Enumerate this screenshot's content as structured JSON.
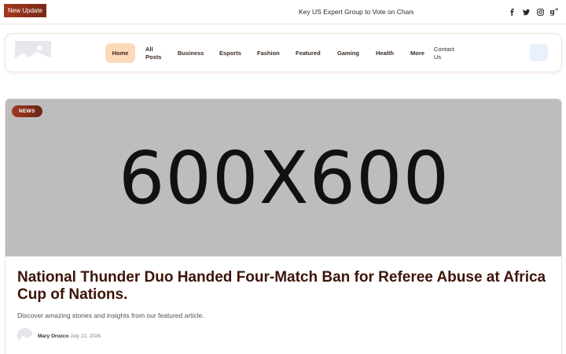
{
  "topbar": {
    "badge_label": "New Update",
    "ticker_text": "Key US Expert Group to Vote on Changing",
    "socials": [
      "facebook-icon",
      "twitter-icon",
      "instagram-icon",
      "google-plus-icon"
    ]
  },
  "header": {
    "nav": [
      {
        "label": "Home",
        "active": true
      },
      {
        "label": "All\nPosts"
      },
      {
        "label": "Business"
      },
      {
        "label": "Esports"
      },
      {
        "label": "Fashion"
      },
      {
        "label": "Featured"
      },
      {
        "label": "Gaming"
      },
      {
        "label": "Health"
      },
      {
        "label": "More"
      },
      {
        "label": "Contact\nUs"
      }
    ],
    "search_icon": "search-icon"
  },
  "featured": {
    "category": "NEWS",
    "image_text": "600X600",
    "title": "National Thunder Duo Handed Four-Match Ban for Referee Abuse at Africa Cup of Nations.",
    "excerpt": "Discover amazing stories and insights from our featured article.",
    "author": "Mary Orozco",
    "date": "July 22, 2026"
  },
  "colors": {
    "accent": "#a2381e",
    "active_nav_bg": "#fcd9b9",
    "headline": "#3e1409",
    "image_placeholder": "#bdbdbd"
  }
}
